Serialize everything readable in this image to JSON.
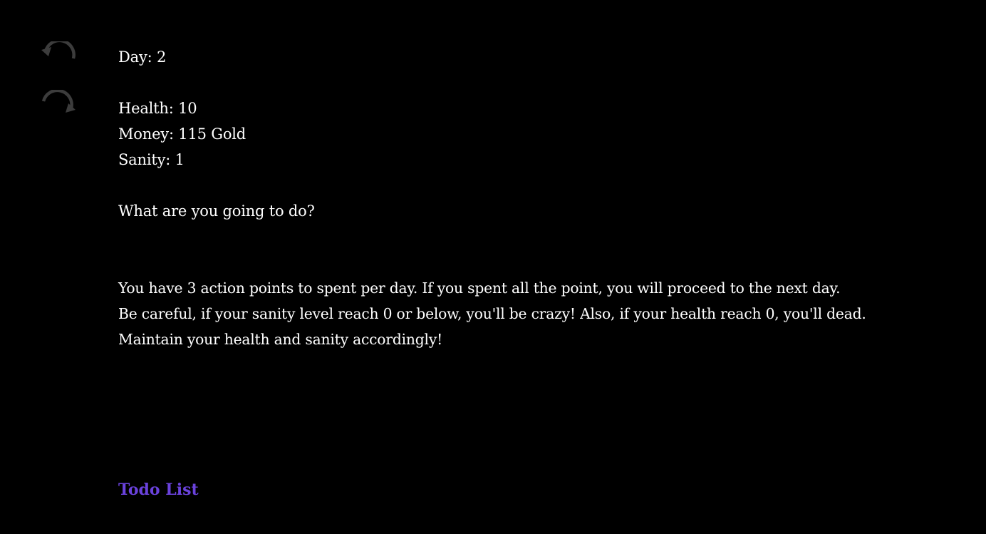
{
  "sidebar": {
    "undo_icon": "undo-arrow-icon",
    "redo_icon": "redo-arrow-icon",
    "icon_color": "#3c3c3c"
  },
  "stats": {
    "day": "Day: 2",
    "health": "Health: 10",
    "money": "Money: 115 Gold",
    "sanity": "Sanity: 1"
  },
  "prompt": "What are you going to do?",
  "instructions": [
    "You have 3 action points to spent per day. If you spent all the point, you will proceed to the next day.",
    "Be careful, if your sanity level reach 0 or below, you'll be crazy! Also, if your health reach 0, you'll dead.",
    "Maintain your health and sanity accordingly!"
  ],
  "todo_link": {
    "label": "Todo List",
    "color": "#6a42dc"
  }
}
